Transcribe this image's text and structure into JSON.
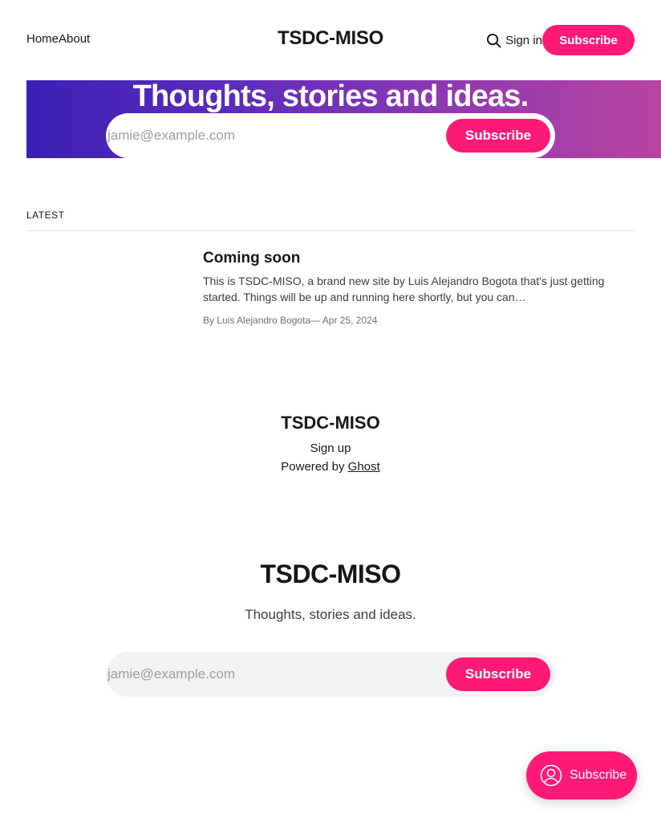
{
  "header": {
    "nav": [
      {
        "label": "Home"
      },
      {
        "label": "About"
      }
    ],
    "site_title": "TSDC-MISO",
    "sign_in_label": "Sign in",
    "subscribe_label": "Subscribe",
    "search_icon": "search-icon"
  },
  "hero": {
    "title": "Thoughts, stories and ideas.",
    "email_placeholder": "jamie@example.com",
    "subscribe_label": "Subscribe"
  },
  "latest": {
    "label": "LATEST",
    "posts": [
      {
        "title": "Coming soon",
        "excerpt": "This is TSDC-MISO, a brand new site by Luis Alejandro Bogota that's just getting started. Things will be up and running here shortly, but you can…",
        "author": "By Luis Alejandro Bogota",
        "date": "— Apr 25, 2024"
      }
    ]
  },
  "footer": {
    "title": "TSDC-MISO",
    "signup_label": "Sign up",
    "powered_prefix": "Powered by ",
    "powered_link": "Ghost"
  },
  "cta": {
    "title": "TSDC-MISO",
    "description": "Thoughts, stories and ideas.",
    "email_placeholder": "jamie@example.com",
    "subscribe_label": "Subscribe"
  },
  "portal": {
    "label": "Subscribe",
    "icon": "user-circle-icon"
  },
  "colors": {
    "accent": "#ff1a75",
    "hero_gradient_start": "#3b20b4",
    "hero_gradient_end": "#b8449f"
  }
}
